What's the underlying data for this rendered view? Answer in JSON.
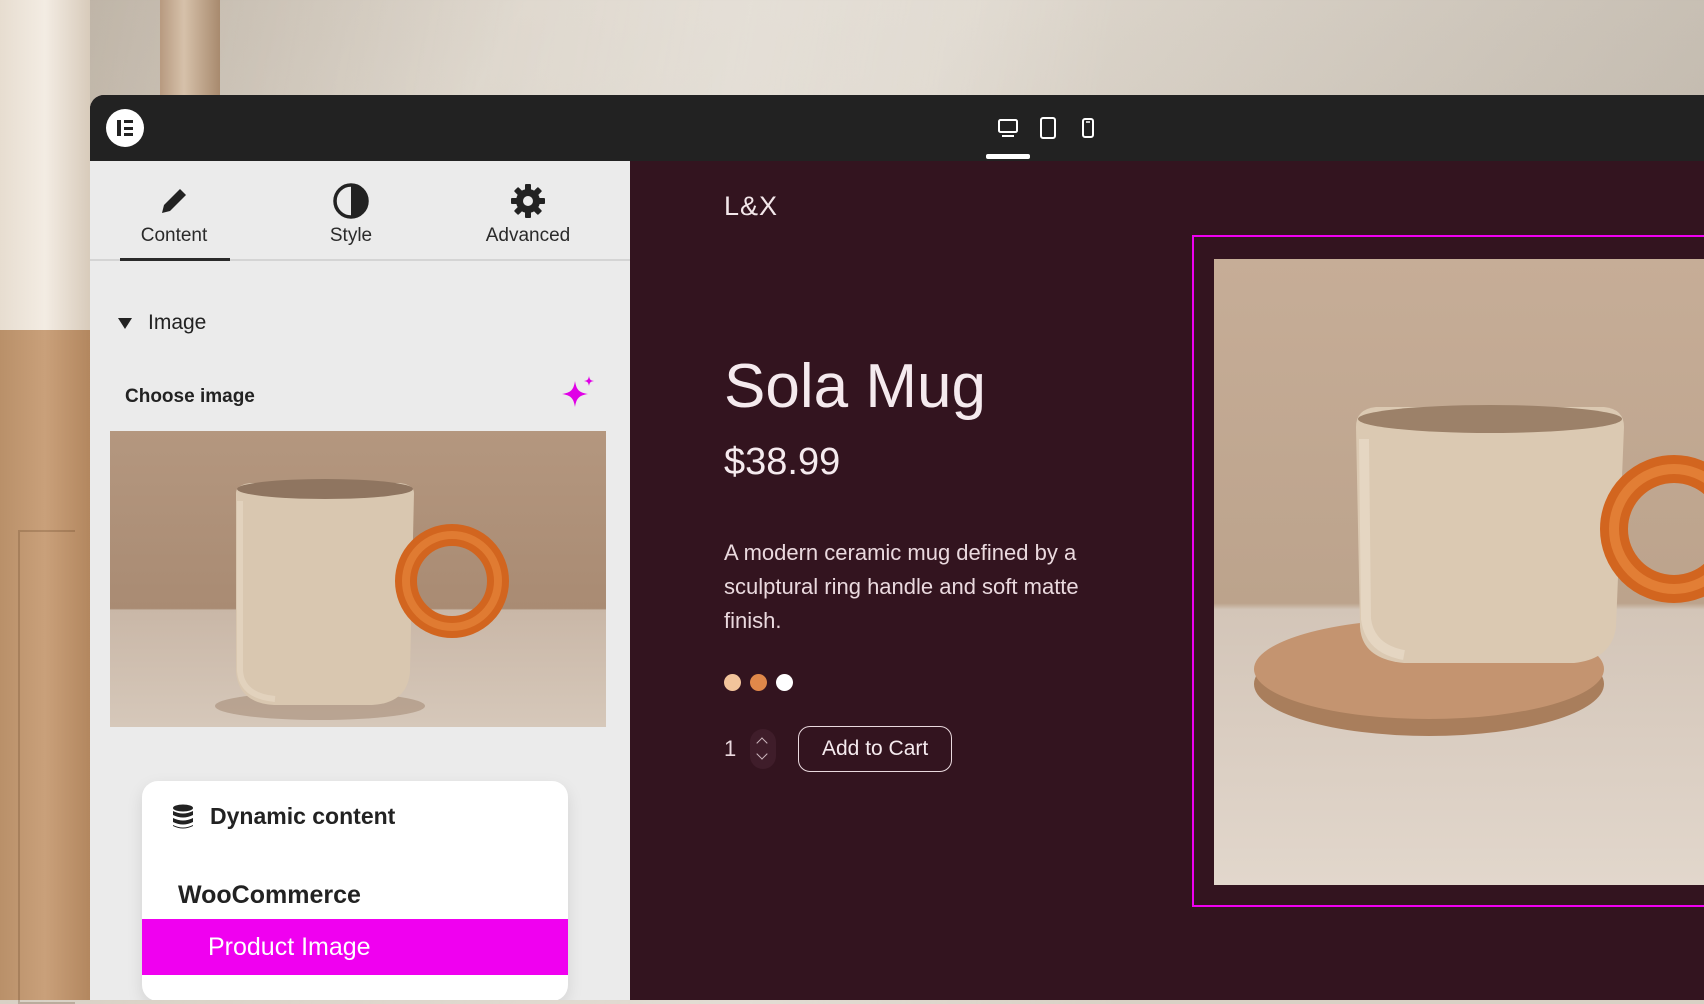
{
  "app": {
    "logo_icon": "elementor-logo-icon"
  },
  "devices": [
    {
      "name": "desktop",
      "icon": "desktop-icon",
      "active": true
    },
    {
      "name": "tablet",
      "icon": "tablet-icon",
      "active": false
    },
    {
      "name": "mobile",
      "icon": "mobile-icon",
      "active": false
    }
  ],
  "panel": {
    "tabs": [
      {
        "label": "Content",
        "icon": "pencil-icon",
        "active": true
      },
      {
        "label": "Style",
        "icon": "contrast-icon",
        "active": false
      },
      {
        "label": "Advanced",
        "icon": "gear-icon",
        "active": false
      }
    ],
    "section_title": "Image",
    "choose_image_label": "Choose image",
    "ai_icon": "sparkle-icon",
    "dynamic": {
      "header": "Dynamic content",
      "group": "WooCommerce",
      "selected_item": "Product Image"
    }
  },
  "canvas": {
    "brand": "L&X",
    "product_title": "Sola Mug",
    "price": "$38.99",
    "description": "A modern ceramic mug defined by a sculptural ring handle and soft matte finish.",
    "swatches": [
      "#f2c49b",
      "#e0884a",
      "#ffffff"
    ],
    "quantity": "1",
    "add_to_cart": "Add to Cart"
  },
  "colors": {
    "accent": "#f000f0",
    "canvas_bg": "#33141f",
    "panel_bg": "#ebebeb",
    "topbar": "#222222"
  }
}
